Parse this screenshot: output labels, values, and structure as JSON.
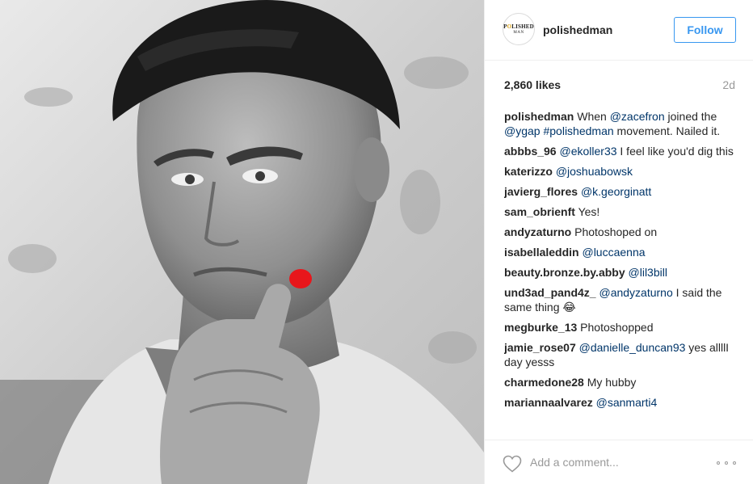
{
  "post": {
    "username": "polishedman",
    "avatar_line1_a": "P",
    "avatar_line1_o": "O",
    "avatar_line1_b": "LISHED",
    "avatar_line2": "MAN",
    "follow_label": "Follow",
    "likes": "2,860 likes",
    "time_ago": "2d"
  },
  "comments": [
    {
      "user": "polishedman",
      "parts": [
        {
          "t": "When "
        },
        {
          "t": "@zacefron",
          "m": true
        },
        {
          "t": " joined the "
        },
        {
          "t": "@ygap",
          "m": true
        },
        {
          "t": " "
        },
        {
          "t": "#polishedman",
          "m": true
        },
        {
          "t": " movement. Nailed it."
        }
      ]
    },
    {
      "user": "abbbs_96",
      "parts": [
        {
          "t": "@ekoller33",
          "m": true
        },
        {
          "t": " I feel like you'd dig this"
        }
      ]
    },
    {
      "user": "katerizzo",
      "parts": [
        {
          "t": "@joshuabowsk",
          "m": true
        }
      ]
    },
    {
      "user": "javierg_flores",
      "parts": [
        {
          "t": "@k.georginatt",
          "m": true
        }
      ]
    },
    {
      "user": "sam_obrienft",
      "parts": [
        {
          "t": "Yes!"
        }
      ]
    },
    {
      "user": "andyzaturno",
      "parts": [
        {
          "t": "Photoshoped on"
        }
      ]
    },
    {
      "user": "isabellaleddin",
      "parts": [
        {
          "t": "@luccaenna",
          "m": true
        }
      ]
    },
    {
      "user": "beauty.bronze.by.abby",
      "parts": [
        {
          "t": "@lil3bill",
          "m": true
        }
      ]
    },
    {
      "user": "und3ad_pand4z_",
      "parts": [
        {
          "t": "@andyzaturno",
          "m": true
        },
        {
          "t": " I said the same thing 😂"
        }
      ]
    },
    {
      "user": "megburke_13",
      "parts": [
        {
          "t": "Photoshopped"
        }
      ]
    },
    {
      "user": "jamie_rose07",
      "parts": [
        {
          "t": "@danielle_duncan93",
          "m": true
        },
        {
          "t": " yes allllI day yesss"
        }
      ]
    },
    {
      "user": "charmedone28",
      "parts": [
        {
          "t": "My hubby"
        }
      ]
    },
    {
      "user": "mariannaalvarez",
      "parts": [
        {
          "t": "@sanmarti4",
          "m": true
        }
      ]
    }
  ],
  "footer": {
    "add_comment_placeholder": "Add a comment...",
    "icons": {
      "like": "heart-icon",
      "more": "more-options-icon"
    }
  },
  "photo": {
    "description_icon": "photo",
    "nail_color": "#e8161b"
  }
}
